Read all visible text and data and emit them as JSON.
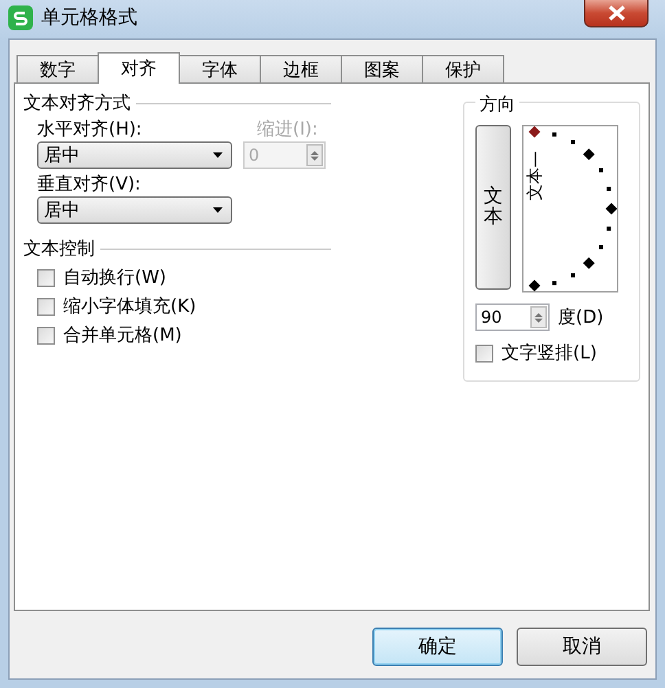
{
  "window": {
    "title": "单元格格式"
  },
  "tabs": [
    {
      "label": "数字",
      "selected": false
    },
    {
      "label": "对齐",
      "selected": true
    },
    {
      "label": "字体",
      "selected": false
    },
    {
      "label": "边框",
      "selected": false
    },
    {
      "label": "图案",
      "selected": false
    },
    {
      "label": "保护",
      "selected": false
    }
  ],
  "alignment": {
    "heading": "文本对齐方式",
    "horizontal": {
      "label": "水平对齐(H):",
      "value": "居中"
    },
    "indent": {
      "label": "缩进(I):",
      "value": "0",
      "disabled": true
    },
    "vertical": {
      "label": "垂直对齐(V):",
      "value": "居中"
    }
  },
  "text_control": {
    "heading": "文本控制",
    "options": [
      {
        "label": "自动换行(W)",
        "checked": false
      },
      {
        "label": "缩小字体填充(K)",
        "checked": false
      },
      {
        "label": "合并单元格(M)",
        "checked": false
      }
    ]
  },
  "orientation": {
    "heading": "方向",
    "vertical_button": "文本",
    "dial_text": "文本—",
    "degrees": "90",
    "degrees_label": "度(D)",
    "vertical_text": {
      "label": "文字竖排(L)",
      "checked": false
    }
  },
  "buttons": [
    {
      "label": "确定",
      "default": true
    },
    {
      "label": "取消",
      "default": false
    }
  ]
}
